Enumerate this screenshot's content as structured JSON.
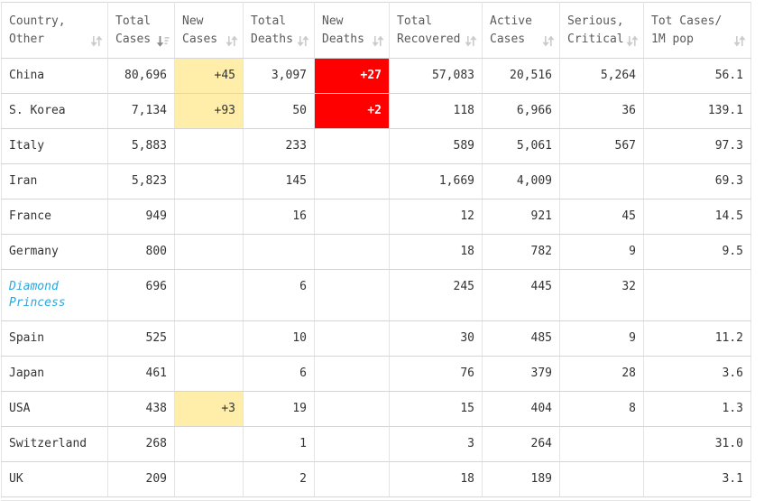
{
  "table": {
    "title": "coronavirus-country-statistics",
    "columns": [
      {
        "id": "country",
        "line1": "Country,",
        "line2": "Other",
        "sort": "none"
      },
      {
        "id": "total_cases",
        "line1": "Total",
        "line2": "Cases",
        "sort": "desc"
      },
      {
        "id": "new_cases",
        "line1": "New",
        "line2": "Cases",
        "sort": "none"
      },
      {
        "id": "total_deaths",
        "line1": "Total",
        "line2": "Deaths",
        "sort": "none"
      },
      {
        "id": "new_deaths",
        "line1": "New",
        "line2": "Deaths",
        "sort": "none"
      },
      {
        "id": "total_recovered",
        "line1": "Total",
        "line2": "Recovered",
        "sort": "none"
      },
      {
        "id": "active_cases",
        "line1": "Active",
        "line2": "Cases",
        "sort": "none"
      },
      {
        "id": "serious_critical",
        "line1": "Serious,",
        "line2": "Critical",
        "sort": "none"
      },
      {
        "id": "cases_per_1m",
        "line1": "Tot Cases/",
        "line2": "1M pop",
        "sort": "none"
      }
    ],
    "rows": [
      {
        "country": "China",
        "is_link": false,
        "total_cases": "80,696",
        "new_cases": "+45",
        "total_deaths": "3,097",
        "new_deaths": "+27",
        "total_recovered": "57,083",
        "active_cases": "20,516",
        "serious_critical": "5,264",
        "cases_per_1m": "56.1"
      },
      {
        "country": "S. Korea",
        "is_link": false,
        "total_cases": "7,134",
        "new_cases": "+93",
        "total_deaths": "50",
        "new_deaths": "+2",
        "total_recovered": "118",
        "active_cases": "6,966",
        "serious_critical": "36",
        "cases_per_1m": "139.1"
      },
      {
        "country": "Italy",
        "is_link": false,
        "total_cases": "5,883",
        "new_cases": "",
        "total_deaths": "233",
        "new_deaths": "",
        "total_recovered": "589",
        "active_cases": "5,061",
        "serious_critical": "567",
        "cases_per_1m": "97.3"
      },
      {
        "country": "Iran",
        "is_link": false,
        "total_cases": "5,823",
        "new_cases": "",
        "total_deaths": "145",
        "new_deaths": "",
        "total_recovered": "1,669",
        "active_cases": "4,009",
        "serious_critical": "",
        "cases_per_1m": "69.3"
      },
      {
        "country": "France",
        "is_link": false,
        "total_cases": "949",
        "new_cases": "",
        "total_deaths": "16",
        "new_deaths": "",
        "total_recovered": "12",
        "active_cases": "921",
        "serious_critical": "45",
        "cases_per_1m": "14.5"
      },
      {
        "country": "Germany",
        "is_link": false,
        "total_cases": "800",
        "new_cases": "",
        "total_deaths": "",
        "new_deaths": "",
        "total_recovered": "18",
        "active_cases": "782",
        "serious_critical": "9",
        "cases_per_1m": "9.5"
      },
      {
        "country": "Diamond Princess",
        "is_link": true,
        "total_cases": "696",
        "new_cases": "",
        "total_deaths": "6",
        "new_deaths": "",
        "total_recovered": "245",
        "active_cases": "445",
        "serious_critical": "32",
        "cases_per_1m": ""
      },
      {
        "country": "Spain",
        "is_link": false,
        "total_cases": "525",
        "new_cases": "",
        "total_deaths": "10",
        "new_deaths": "",
        "total_recovered": "30",
        "active_cases": "485",
        "serious_critical": "9",
        "cases_per_1m": "11.2"
      },
      {
        "country": "Japan",
        "is_link": false,
        "total_cases": "461",
        "new_cases": "",
        "total_deaths": "6",
        "new_deaths": "",
        "total_recovered": "76",
        "active_cases": "379",
        "serious_critical": "28",
        "cases_per_1m": "3.6"
      },
      {
        "country": "USA",
        "is_link": false,
        "total_cases": "438",
        "new_cases": "+3",
        "total_deaths": "19",
        "new_deaths": "",
        "total_recovered": "15",
        "active_cases": "404",
        "serious_critical": "8",
        "cases_per_1m": "1.3"
      },
      {
        "country": "Switzerland",
        "is_link": false,
        "total_cases": "268",
        "new_cases": "",
        "total_deaths": "1",
        "new_deaths": "",
        "total_recovered": "3",
        "active_cases": "264",
        "serious_critical": "",
        "cases_per_1m": "31.0"
      },
      {
        "country": "UK",
        "is_link": false,
        "total_cases": "209",
        "new_cases": "",
        "total_deaths": "2",
        "new_deaths": "",
        "total_recovered": "18",
        "active_cases": "189",
        "serious_critical": "",
        "cases_per_1m": "3.1"
      }
    ]
  },
  "colors": {
    "highlight_new_cases": "#FFEEAA",
    "highlight_new_deaths": "#FF0000",
    "link_blue": "#2BA7E0",
    "header_text": "#5A5A5A",
    "body_text": "#333333",
    "border": "#D5D5D5",
    "sort_icon_inactive": "#CCCCCC",
    "sort_icon_active": "#8A8A8A"
  }
}
